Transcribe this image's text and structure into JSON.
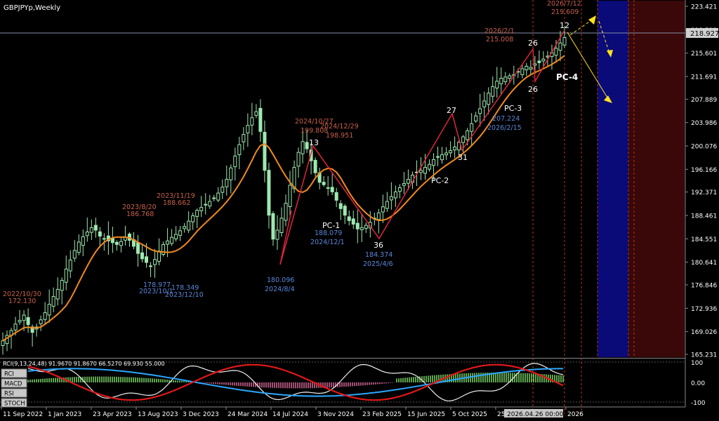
{
  "window": {
    "title": "GBPJPYp,Weekly",
    "current_price": "218.927",
    "status_time": "2026.04.26 00:00"
  },
  "price_axis": [
    "223.421",
    "219.511",
    "215.601",
    "211.691",
    "207.889",
    "203.986",
    "200.076",
    "196.166",
    "192.371",
    "188.461",
    "184.551",
    "180.641",
    "176.846",
    "172.936",
    "169.026",
    "165.231"
  ],
  "time_axis": [
    "11 Sep 2022",
    "1 Jan 2023",
    "23 Apr 2023",
    "13 Aug 2023",
    "3 Dec 2023",
    "24 Mar 2024",
    "14 Jul 2024",
    "3 Nov 2024",
    "23 Feb 2025",
    "15 Jun 2025",
    "5 Oct 2025",
    "25",
    "2026"
  ],
  "osc_axis": [
    "100",
    "0.00",
    "-100"
  ],
  "osc_tabs": [
    "RCI",
    "MACD",
    "RSI",
    "STOCH"
  ],
  "osc_title": "RCI(9,13,24,48) 91.9670 91.8670 66.5270 69.930 55.000",
  "wave_labels": {
    "w12": "12",
    "w13": "13",
    "w26a": "26",
    "w26b": "26",
    "w27": "27",
    "w31": "31",
    "w36": "36",
    "pc1": "PC-1",
    "pc2": "PC-2",
    "pc3": "PC-3",
    "pc4": "PC-4"
  },
  "annotations": {
    "a1_date": "2022/10/30",
    "a1_val": "172.130",
    "a2_date": "2023/8/20",
    "a2_val": "186.768",
    "a3_date": "2023/11/19",
    "a3_val": "188.662",
    "a4_val": "178.977",
    "a4_date": "2023/10/1",
    "a5_val": "178.349",
    "a5_date": "2023/12/10",
    "a6_val": "180.096",
    "a6_date": "2024/8/4",
    "a7_date": "2024/10/27",
    "a7_val": "199.808",
    "a8_date": "2024/12/29",
    "a8_val": "198.951",
    "a9_val": "188.079",
    "a9_date": "2024/12/1",
    "a10_val": "184.374",
    "a10_date": "2025/4/6",
    "a11_val": "207.224",
    "a11_date": "2026/2/15",
    "a12_date": "2026/2/1",
    "a12_val": "215.008",
    "a13_date": "2026/7/12",
    "a13_val": "219.609"
  },
  "colors": {
    "candle": "#9ee8b0",
    "ma": "#f08a1e",
    "wave": "#e0243c",
    "red_text": "#c8604a",
    "blue_text": "#5a86d8",
    "future_blue": "#0a0a78",
    "future_red": "#3a0808",
    "arrow": "#ffe21a"
  },
  "chart_data": {
    "type": "candlestick",
    "timeframe": "Weekly",
    "symbol": "GBPJPYp",
    "ylim": [
      165.231,
      223.421
    ],
    "wave_points": [
      {
        "label": "180.096",
        "date": "2024/8/4"
      },
      {
        "label": "13",
        "date": "2024/10/27",
        "value": 199.808
      },
      {
        "label": "36",
        "date": "2025/4/6",
        "value": 184.374
      },
      {
        "label": "27"
      },
      {
        "label": "31"
      },
      {
        "label": "26"
      },
      {
        "label": "12",
        "date": "2026/7/12",
        "value": 219.609
      }
    ],
    "close_series": [
      167.5,
      168.4,
      169.2,
      170.3,
      170.9,
      171.8,
      170.2,
      168.9,
      169.8,
      171.0,
      172.2,
      173.6,
      174.9,
      176.1,
      177.6,
      179.5,
      181.0,
      182.6,
      184.0,
      184.9,
      185.7,
      186.4,
      186.0,
      185.0,
      184.6,
      184.2,
      183.9,
      183.6,
      184.1,
      184.8,
      184.3,
      183.3,
      182.1,
      181.2,
      180.6,
      180.0,
      181.1,
      182.5,
      183.6,
      184.2,
      184.8,
      185.3,
      185.9,
      186.6,
      187.5,
      188.4,
      189.3,
      189.8,
      190.3,
      190.8,
      191.4,
      192.2,
      193.2,
      194.5,
      196.4,
      198.4,
      200.3,
      202.0,
      203.5,
      204.8,
      205.8,
      202.5,
      196.0,
      188.5,
      184.5,
      186.0,
      188.0,
      190.5,
      193.5,
      196.5,
      199.0,
      200.8,
      199.6,
      197.6,
      195.6,
      194.0,
      193.6,
      193.1,
      192.4,
      191.0,
      189.6,
      188.5,
      187.6,
      187.0,
      186.2,
      186.4,
      186.8,
      187.3,
      188.0,
      188.9,
      189.9,
      190.8,
      191.6,
      192.4,
      193.1,
      193.8,
      194.5,
      195.2,
      195.7,
      196.0,
      196.5,
      197.0,
      197.8,
      198.3,
      198.6,
      198.9,
      199.3,
      199.9,
      200.7,
      201.6,
      202.6,
      203.8,
      205.1,
      206.3,
      207.6,
      208.9,
      210.0,
      210.9,
      211.4,
      211.6,
      211.8,
      212.0,
      212.5,
      213.0,
      213.4,
      213.2,
      213.8,
      214.0,
      214.6,
      215.1,
      215.7,
      216.4,
      217.3,
      218.2
    ]
  }
}
